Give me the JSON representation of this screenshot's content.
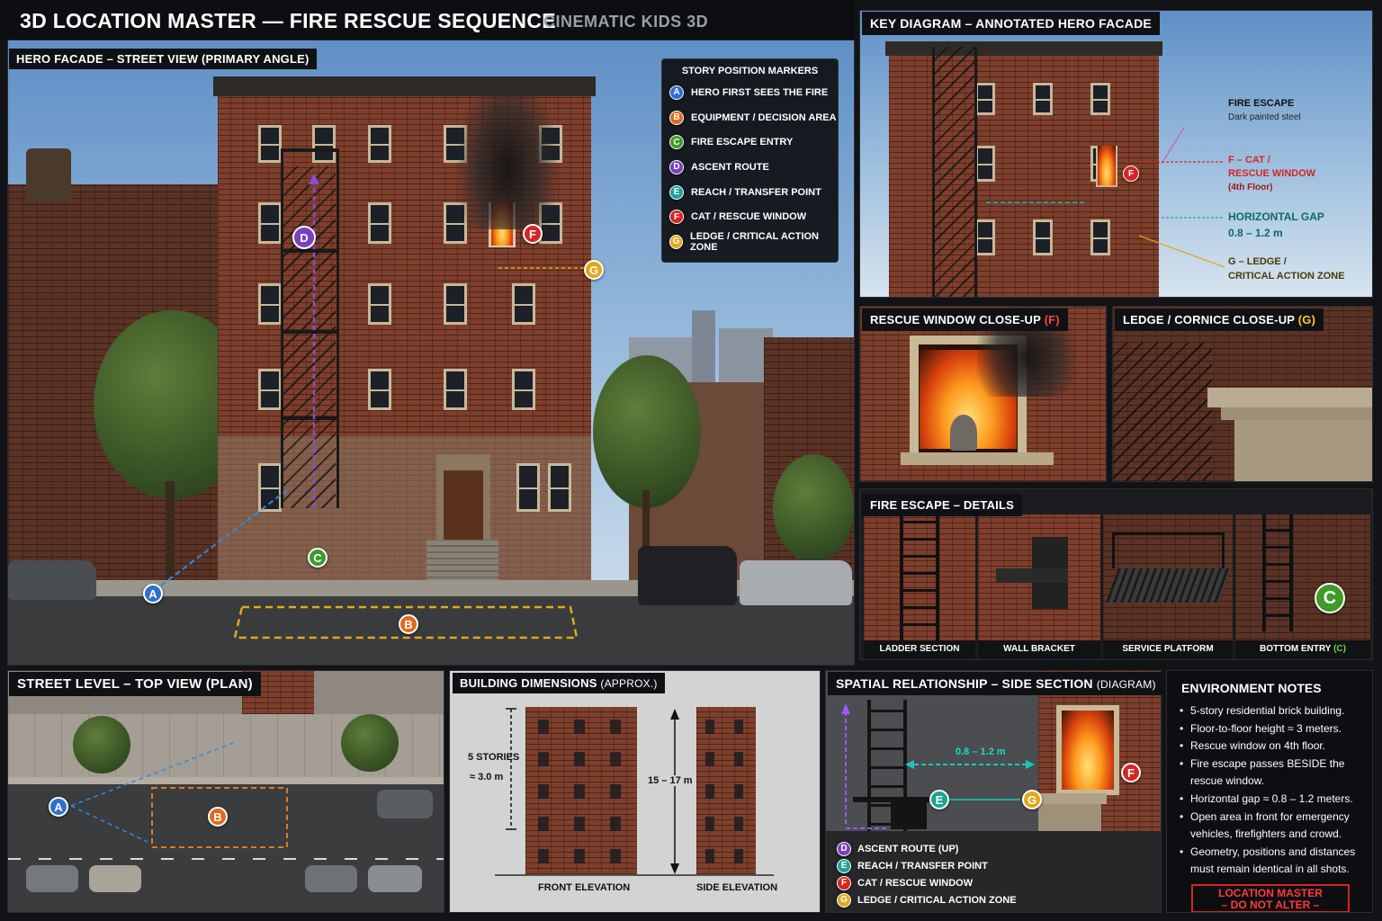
{
  "header": {
    "title": "3D LOCATION MASTER — FIRE RESCUE SEQUENCE",
    "studio": "CINEMATIC KIDS 3D"
  },
  "hero": {
    "label": "HERO FACADE – STREET VIEW (PRIMARY ANGLE)"
  },
  "legend": {
    "title": "STORY POSITION MARKERS",
    "items": [
      {
        "letter": "A",
        "text": "HERO FIRST SEES THE FIRE"
      },
      {
        "letter": "B",
        "text": "EQUIPMENT / DECISION AREA"
      },
      {
        "letter": "C",
        "text": "FIRE ESCAPE ENTRY"
      },
      {
        "letter": "D",
        "text": "ASCENT ROUTE"
      },
      {
        "letter": "E",
        "text": "REACH / TRANSFER POINT"
      },
      {
        "letter": "F",
        "text": "CAT / RESCUE WINDOW"
      },
      {
        "letter": "G",
        "text": "LEDGE / CRITICAL ACTION ZONE"
      }
    ]
  },
  "markers": {
    "a": "A",
    "b": "B",
    "c": "C",
    "d": "D",
    "e": "E",
    "f": "F",
    "g": "G"
  },
  "colors": {
    "a": "#2f6fd0",
    "b": "#e06a1e",
    "c": "#3f9a2a",
    "d": "#7b3fc0",
    "e": "#1aa39a",
    "f": "#d52525",
    "g": "#e0a91a"
  },
  "key": {
    "label": "KEY DIAGRAM – ANNOTATED HERO FACADE",
    "fire_escape": "FIRE ESCAPE",
    "fire_escape_sub": "Dark painted steel",
    "f_line1": "F – CAT /",
    "f_line2": "RESCUE WINDOW",
    "f_line3": "(4th Floor)",
    "gap_line1": "HORIZONTAL GAP",
    "gap_line2": "0.8 – 1.2 m",
    "g_line1": "G – LEDGE /",
    "g_line2": "CRITICAL ACTION ZONE"
  },
  "rescue_closeup": {
    "label": "RESCUE WINDOW CLOSE-UP",
    "tag": "(F)"
  },
  "ledge_closeup": {
    "label": "LEDGE / CORNICE CLOSE-UP",
    "tag": "(G)"
  },
  "fire_escape_details": {
    "label": "FIRE ESCAPE – DETAILS",
    "items": [
      "LADDER SECTION",
      "WALL BRACKET",
      "SERVICE PLATFORM",
      "BOTTOM ENTRY"
    ],
    "bottom_tag": "(C)"
  },
  "plan": {
    "label": "STREET LEVEL – TOP VIEW (PLAN)"
  },
  "dimensions": {
    "label": "BUILDING DIMENSIONS",
    "label_sub": "(APPROX.)",
    "stories": "5 STORIES",
    "story_height": "≈ 3.0 m",
    "total_height": "15 – 17 m",
    "front": "FRONT ELEVATION",
    "side": "SIDE ELEVATION"
  },
  "section": {
    "label": "SPATIAL RELATIONSHIP – SIDE SECTION",
    "label_sub": "(DIAGRAM)",
    "gap": "0.8 – 1.2 m",
    "legend": [
      {
        "letter": "D",
        "text": "ASCENT ROUTE (UP)"
      },
      {
        "letter": "E",
        "text": "REACH / TRANSFER POINT"
      },
      {
        "letter": "F",
        "text": "CAT / RESCUE WINDOW"
      },
      {
        "letter": "G",
        "text": "LEDGE / CRITICAL ACTION ZONE"
      }
    ]
  },
  "notes": {
    "title": "ENVIRONMENT NOTES",
    "items": [
      "5-story residential brick building.",
      "Floor-to-floor height ≈ 3 meters.",
      "Rescue window on 4th floor.",
      "Fire escape passes BESIDE the rescue window.",
      "Horizontal gap ≈ 0.8 – 1.2 meters.",
      "Open area in front for emergency vehicles, firefighters and crowd.",
      "Geometry, positions and distances must remain identical in all shots."
    ],
    "stamp_line1": "LOCATION MASTER",
    "stamp_line2": "– DO NOT ALTER –"
  }
}
